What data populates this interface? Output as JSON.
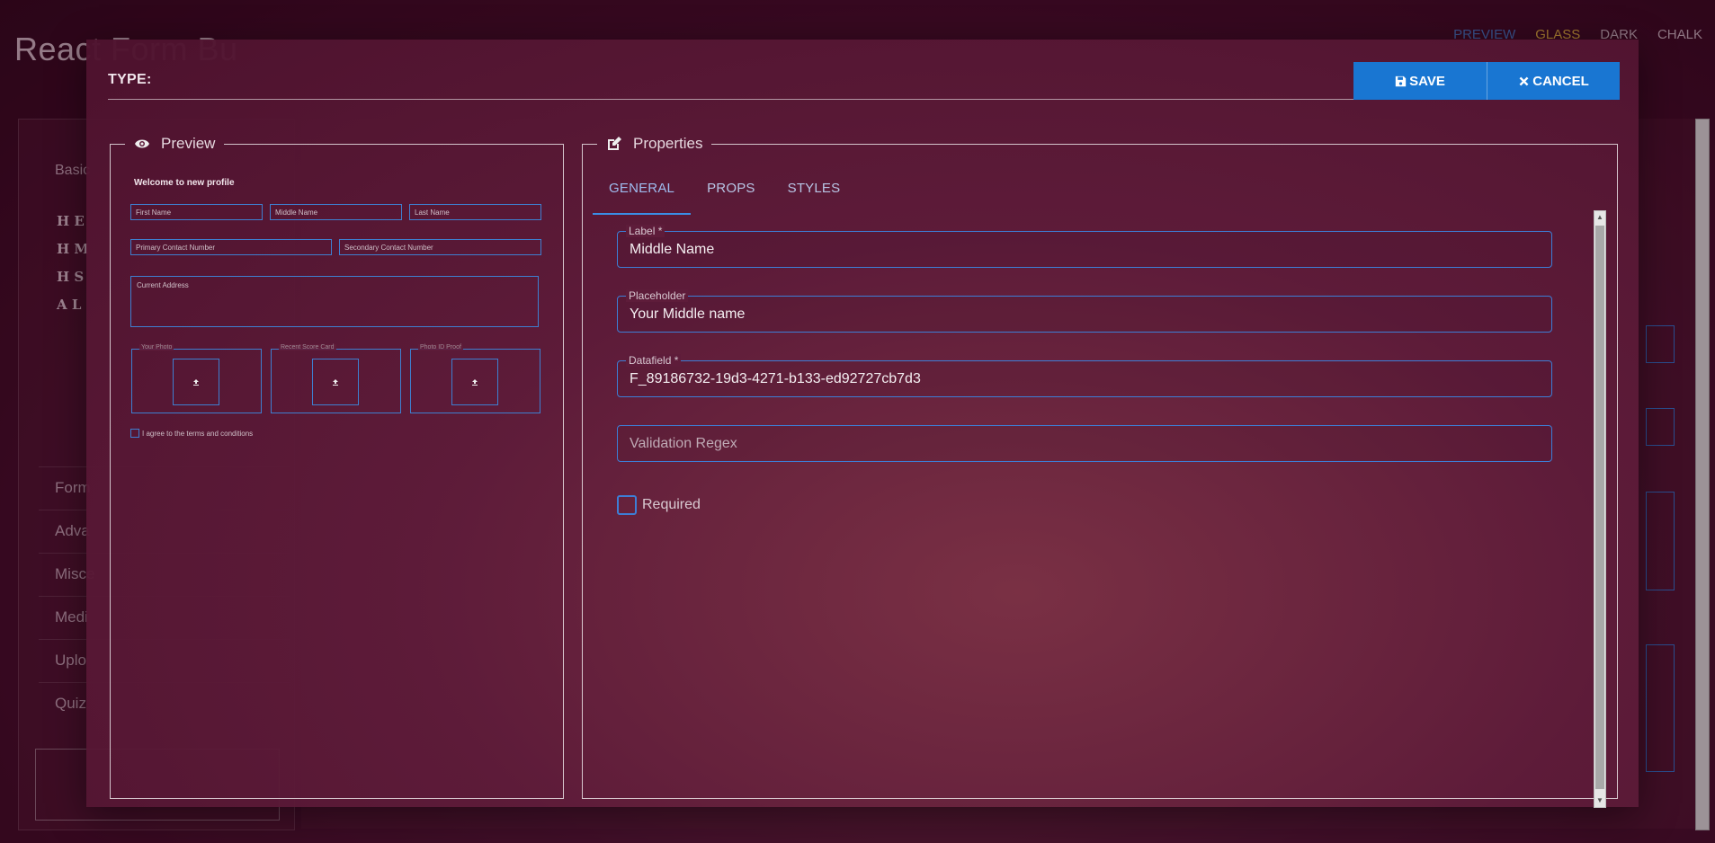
{
  "background": {
    "app_title": "React Form Bu",
    "themes": [
      {
        "label": "PREVIEW",
        "color": "#3f6fb8"
      },
      {
        "label": "GLASS",
        "color": "#d2a63a"
      },
      {
        "label": "DARK",
        "color": "#b8a2ad"
      },
      {
        "label": "CHALK",
        "color": "#b8a2ad"
      }
    ],
    "sidebar": {
      "basic_label": "Basic",
      "rows": [
        "H E",
        "H M",
        "H S",
        "A L"
      ],
      "items": [
        "Form",
        "Adva",
        "Misce",
        "Medi",
        "Uplo",
        "Quiz"
      ]
    }
  },
  "modal": {
    "title": "TYPE:",
    "save_label": "SAVE",
    "cancel_label": "CANCEL",
    "preview": {
      "legend": "Preview",
      "heading": "Welcome to new profile",
      "first_name": "First Name",
      "middle_name": "Middle Name",
      "last_name": "Last Name",
      "primary_contact": "Primary Contact Number",
      "secondary_contact": "Secondary Contact Number",
      "address": "Current Address",
      "uploads": [
        "Your Photo",
        "Recent Score Card",
        "Photo ID Proof"
      ],
      "agree": "I agree to the terms and conditions"
    },
    "properties": {
      "legend": "Properties",
      "tabs": [
        "GENERAL",
        "PROPS",
        "STYLES"
      ],
      "active_tab": "GENERAL",
      "label_field": {
        "label": "Label *",
        "value": "Middle Name"
      },
      "placeholder_field": {
        "label": "Placeholder",
        "value": "Your Middle name"
      },
      "datafield_field": {
        "label": "Datafield *",
        "value": "F_89186732-19d3-4271-b133-ed92727cb7d3"
      },
      "validation_field": {
        "placeholder": "Validation Regex"
      },
      "required_label": "Required",
      "required_checked": false
    }
  }
}
